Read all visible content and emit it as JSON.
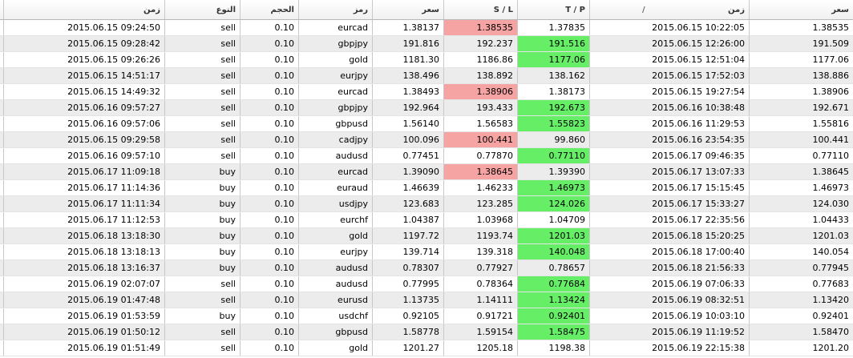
{
  "headers": {
    "open_time": "زمن",
    "type": "النوع",
    "volume": "الحجم",
    "symbol": "رمز",
    "open_price": "سعر",
    "sl": "S / L",
    "tp": "T / P",
    "close_time": "زمن",
    "close_sort_mark": "/",
    "close_price": "سعر"
  },
  "colors": {
    "sl_hit": "#f5a3a3",
    "tp_hit": "#66ee66",
    "alt_row": "#ececec"
  },
  "rows": [
    {
      "open_time": "2015.06.15 09:24:50",
      "type": "sell",
      "volume": "0.10",
      "symbol": "eurcad",
      "open_price": "1.38137",
      "sl": "1.38535",
      "tp": "1.37835",
      "close_time": "2015.06.15 10:22:05",
      "close_price": "1.38535",
      "hit": "sl"
    },
    {
      "open_time": "2015.06.15 09:28:42",
      "type": "sell",
      "volume": "0.10",
      "symbol": "gbpjpy",
      "open_price": "191.816",
      "sl": "192.237",
      "tp": "191.516",
      "close_time": "2015.06.15 12:26:00",
      "close_price": "191.509",
      "hit": "tp"
    },
    {
      "open_time": "2015.06.15 09:26:26",
      "type": "sell",
      "volume": "0.10",
      "symbol": "gold",
      "open_price": "1181.30",
      "sl": "1186.86",
      "tp": "1177.06",
      "close_time": "2015.06.15 12:51:04",
      "close_price": "1177.06",
      "hit": "tp"
    },
    {
      "open_time": "2015.06.15 14:51:17",
      "type": "sell",
      "volume": "0.10",
      "symbol": "eurjpy",
      "open_price": "138.496",
      "sl": "138.892",
      "tp": "138.162",
      "close_time": "2015.06.15 17:52:03",
      "close_price": "138.886",
      "hit": ""
    },
    {
      "open_time": "2015.06.15 14:49:32",
      "type": "sell",
      "volume": "0.10",
      "symbol": "eurcad",
      "open_price": "1.38493",
      "sl": "1.38906",
      "tp": "1.38173",
      "close_time": "2015.06.15 19:27:54",
      "close_price": "1.38906",
      "hit": "sl"
    },
    {
      "open_time": "2015.06.16 09:57:27",
      "type": "sell",
      "volume": "0.10",
      "symbol": "gbpjpy",
      "open_price": "192.964",
      "sl": "193.433",
      "tp": "192.673",
      "close_time": "2015.06.16 10:38:48",
      "close_price": "192.671",
      "hit": "tp"
    },
    {
      "open_time": "2015.06.16 09:57:06",
      "type": "sell",
      "volume": "0.10",
      "symbol": "gbpusd",
      "open_price": "1.56140",
      "sl": "1.56583",
      "tp": "1.55823",
      "close_time": "2015.06.16 11:29:53",
      "close_price": "1.55816",
      "hit": "tp"
    },
    {
      "open_time": "2015.06.15 09:29:58",
      "type": "sell",
      "volume": "0.10",
      "symbol": "cadjpy",
      "open_price": "100.096",
      "sl": "100.441",
      "tp": "99.860",
      "close_time": "2015.06.16 23:54:35",
      "close_price": "100.441",
      "hit": "sl"
    },
    {
      "open_time": "2015.06.16 09:57:10",
      "type": "sell",
      "volume": "0.10",
      "symbol": "audusd",
      "open_price": "0.77451",
      "sl": "0.77870",
      "tp": "0.77110",
      "close_time": "2015.06.17 09:46:35",
      "close_price": "0.77110",
      "hit": "tp"
    },
    {
      "open_time": "2015.06.17 11:09:18",
      "type": "buy",
      "volume": "0.10",
      "symbol": "eurcad",
      "open_price": "1.39090",
      "sl": "1.38645",
      "tp": "1.39390",
      "close_time": "2015.06.17 13:07:33",
      "close_price": "1.38645",
      "hit": "sl"
    },
    {
      "open_time": "2015.06.17 11:14:36",
      "type": "buy",
      "volume": "0.10",
      "symbol": "euraud",
      "open_price": "1.46639",
      "sl": "1.46233",
      "tp": "1.46973",
      "close_time": "2015.06.17 15:15:45",
      "close_price": "1.46973",
      "hit": "tp"
    },
    {
      "open_time": "2015.06.17 11:11:34",
      "type": "buy",
      "volume": "0.10",
      "symbol": "usdjpy",
      "open_price": "123.683",
      "sl": "123.285",
      "tp": "124.026",
      "close_time": "2015.06.17 15:33:27",
      "close_price": "124.030",
      "hit": "tp"
    },
    {
      "open_time": "2015.06.17 11:12:53",
      "type": "buy",
      "volume": "0.10",
      "symbol": "eurchf",
      "open_price": "1.04387",
      "sl": "1.03968",
      "tp": "1.04709",
      "close_time": "2015.06.17 22:35:56",
      "close_price": "1.04433",
      "hit": ""
    },
    {
      "open_time": "2015.06.18 13:18:30",
      "type": "buy",
      "volume": "0.10",
      "symbol": "gold",
      "open_price": "1197.72",
      "sl": "1193.74",
      "tp": "1201.03",
      "close_time": "2015.06.18 15:20:25",
      "close_price": "1201.03",
      "hit": "tp"
    },
    {
      "open_time": "2015.06.18 13:18:13",
      "type": "buy",
      "volume": "0.10",
      "symbol": "eurjpy",
      "open_price": "139.714",
      "sl": "139.318",
      "tp": "140.048",
      "close_time": "2015.06.18 17:00:40",
      "close_price": "140.054",
      "hit": "tp"
    },
    {
      "open_time": "2015.06.18 13:16:37",
      "type": "buy",
      "volume": "0.10",
      "symbol": "audusd",
      "open_price": "0.78307",
      "sl": "0.77927",
      "tp": "0.78657",
      "close_time": "2015.06.18 21:56:33",
      "close_price": "0.77945",
      "hit": ""
    },
    {
      "open_time": "2015.06.19 02:07:07",
      "type": "sell",
      "volume": "0.10",
      "symbol": "audusd",
      "open_price": "0.77995",
      "sl": "0.78364",
      "tp": "0.77684",
      "close_time": "2015.06.19 07:06:33",
      "close_price": "0.77683",
      "hit": "tp"
    },
    {
      "open_time": "2015.06.19 01:47:48",
      "type": "sell",
      "volume": "0.10",
      "symbol": "eurusd",
      "open_price": "1.13735",
      "sl": "1.14111",
      "tp": "1.13424",
      "close_time": "2015.06.19 08:32:51",
      "close_price": "1.13420",
      "hit": "tp"
    },
    {
      "open_time": "2015.06.19 01:53:59",
      "type": "buy",
      "volume": "0.10",
      "symbol": "usdchf",
      "open_price": "0.92105",
      "sl": "0.91721",
      "tp": "0.92401",
      "close_time": "2015.06.19 10:03:10",
      "close_price": "0.92401",
      "hit": "tp"
    },
    {
      "open_time": "2015.06.19 01:50:12",
      "type": "sell",
      "volume": "0.10",
      "symbol": "gbpusd",
      "open_price": "1.58778",
      "sl": "1.59154",
      "tp": "1.58475",
      "close_time": "2015.06.19 11:19:52",
      "close_price": "1.58470",
      "hit": "tp"
    },
    {
      "open_time": "2015.06.19 01:51:49",
      "type": "sell",
      "volume": "0.10",
      "symbol": "gold",
      "open_price": "1201.27",
      "sl": "1205.18",
      "tp": "1198.38",
      "close_time": "2015.06.19 22:15:38",
      "close_price": "1201.20",
      "hit": ""
    }
  ]
}
